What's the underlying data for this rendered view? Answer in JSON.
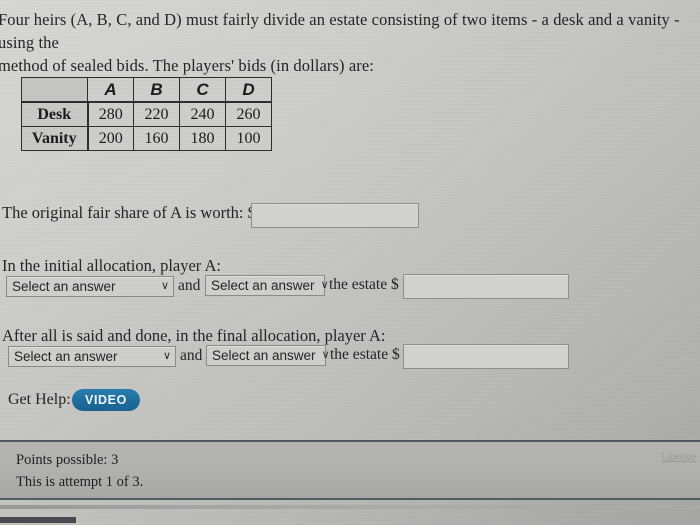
{
  "prompt": {
    "line1": "Four heirs (A, B, C, and D) must fairly divide an estate consisting of two items - a desk and a vanity - using the",
    "line2": "method of sealed bids. The players' bids (in dollars) are:"
  },
  "bid_table": {
    "corner_label": "",
    "columns": [
      "A",
      "B",
      "C",
      "D"
    ],
    "rows": [
      {
        "label": "Desk",
        "values": [
          "280",
          "220",
          "240",
          "260"
        ]
      },
      {
        "label": "Vanity",
        "values": [
          "200",
          "160",
          "180",
          "100"
        ]
      }
    ]
  },
  "fair_share": {
    "label": "The original fair share of A is worth: $",
    "input_value": "",
    "placeholder": ""
  },
  "initial_allocation": {
    "heading": "In the initial allocation, player A:",
    "select1_value": "Select an answer",
    "conjunction": "and",
    "select2_value": "Select an answer",
    "tail_label": "the estate $",
    "input_value": "",
    "chevron": "∨"
  },
  "final_allocation": {
    "heading": "After all is said and done, in the final allocation, player A:",
    "select1_value": "Select an answer",
    "conjunction": "and",
    "select2_value": "Select an answer",
    "tail_label": "the estate $",
    "input_value": "",
    "chevron": "∨"
  },
  "help": {
    "label": "Get Help:",
    "video_button": "VIDEO"
  },
  "footer": {
    "points_possible": "Points possible: 3",
    "attempt": "This is attempt 1 of 3.",
    "license_link": "License"
  },
  "colors": {
    "accent_blue": "#1d6e9e",
    "page_bg": "#c9c9c6",
    "footer_bg": "#b1b1ae",
    "footer_border": "#555a66"
  }
}
